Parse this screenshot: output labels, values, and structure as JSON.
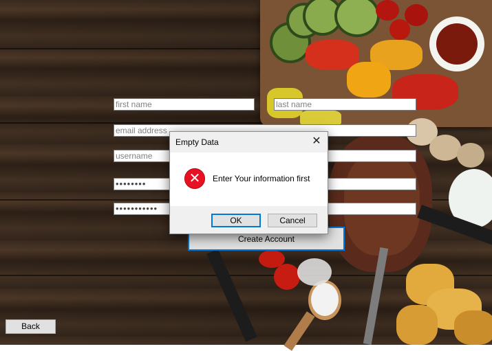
{
  "form": {
    "first_name_placeholder": "first name",
    "last_name_placeholder": "last name",
    "email_placeholder": "email address",
    "username_placeholder": "username",
    "password_value": "••••••••",
    "confirm_password_value": "•••••••••••",
    "create_account_label": "Create Account",
    "back_label": "Back"
  },
  "dialog": {
    "title": "Empty Data",
    "message": "Enter Your information first",
    "ok_label": "OK",
    "cancel_label": "Cancel",
    "close_glyph": "✕",
    "error_glyph": "✕",
    "icon": "error-icon",
    "accent_color": "#e81123",
    "default_button_border": "#0078d7"
  }
}
